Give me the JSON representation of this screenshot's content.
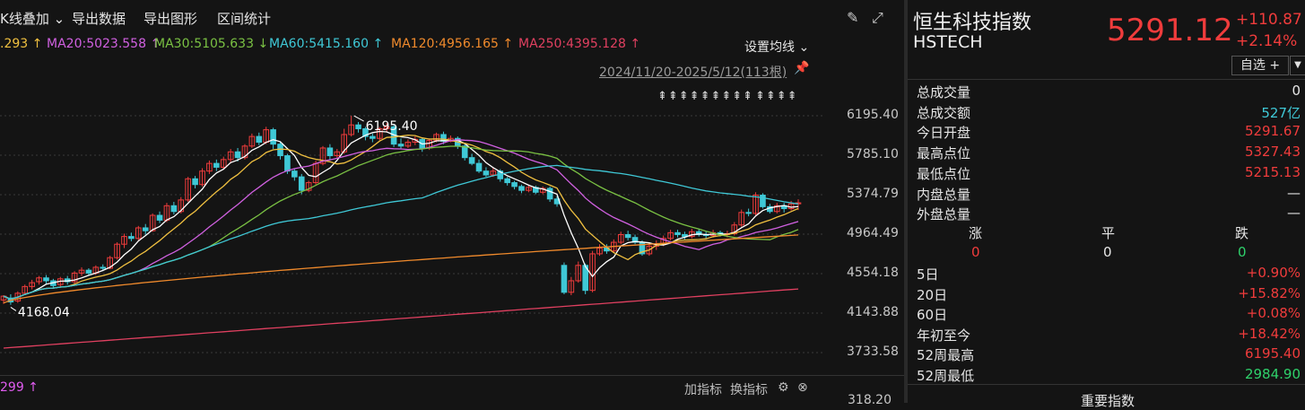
{
  "toolbar": {
    "kline_overlay": "K线叠加",
    "export_data": "导出数据",
    "export_chart": "导出图形",
    "range_stats": "区间统计",
    "icons": [
      "edit-icon",
      "expand-icon"
    ]
  },
  "ma_legend": [
    {
      "text": ".293",
      "color": "#f0c040",
      "arrow": "↑"
    },
    {
      "text": "MA20:5023.558",
      "color": "#d060e0",
      "arrow": "↑"
    },
    {
      "text": "MA30:5105.633",
      "color": "#7ac143",
      "arrow": "↓"
    },
    {
      "text": "MA60:5415.160",
      "color": "#3fc8d6",
      "arrow": "↑"
    },
    {
      "text": "MA120:4956.165",
      "color": "#f08a2c",
      "arrow": "↑"
    },
    {
      "text": "MA250:4395.128",
      "color": "#e04060",
      "arrow": "↑"
    }
  ],
  "ma_settings": "设置均线",
  "date_range": "2024/11/20-2025/5/12(113根)",
  "signal_groups": [
    "⇞⇞⇞⇞⇞⇞⇞⇞⇞",
    "⇞⇞⇞⇞"
  ],
  "chart_data": {
    "type": "candlestick",
    "y_ticks": [
      "6195.40",
      "5785.10",
      "5374.79",
      "4964.49",
      "4554.18",
      "4143.88",
      "3733.58"
    ],
    "ylim": [
      3600,
      6400
    ],
    "annotations": {
      "high_label": "6195.40",
      "low_label": "4168.04"
    },
    "colors": {
      "up": "#f03c3c",
      "down": "#3fc8d6",
      "ma5": "#ffffff",
      "ma10": "#f0c040",
      "ma20": "#d060e0",
      "ma30": "#7ac143",
      "ma60": "#3fc8d6",
      "ma120": "#f08a2c",
      "ma250": "#e04060"
    },
    "candles": [
      [
        4280,
        4320,
        4240,
        4330
      ],
      [
        4300,
        4260,
        4230,
        4340
      ],
      [
        4270,
        4350,
        4250,
        4370
      ],
      [
        4350,
        4420,
        4330,
        4440
      ],
      [
        4420,
        4460,
        4390,
        4490
      ],
      [
        4470,
        4510,
        4440,
        4530
      ],
      [
        4510,
        4480,
        4450,
        4540
      ],
      [
        4480,
        4430,
        4400,
        4500
      ],
      [
        4440,
        4500,
        4420,
        4520
      ],
      [
        4500,
        4470,
        4440,
        4530
      ],
      [
        4470,
        4560,
        4450,
        4580
      ],
      [
        4560,
        4590,
        4530,
        4620
      ],
      [
        4590,
        4560,
        4540,
        4610
      ],
      [
        4560,
        4620,
        4540,
        4640
      ],
      [
        4620,
        4610,
        4580,
        4650
      ],
      [
        4610,
        4720,
        4600,
        4740
      ],
      [
        4720,
        4860,
        4700,
        4880
      ],
      [
        4860,
        4940,
        4820,
        4970
      ],
      [
        4940,
        4920,
        4890,
        4980
      ],
      [
        4920,
        5030,
        4900,
        5050
      ],
      [
        5030,
        5000,
        4960,
        5070
      ],
      [
        5000,
        5160,
        4990,
        5180
      ],
      [
        5160,
        5110,
        5080,
        5200
      ],
      [
        5110,
        5260,
        5090,
        5290
      ],
      [
        5260,
        5200,
        5170,
        5300
      ],
      [
        5200,
        5320,
        5180,
        5350
      ],
      [
        5320,
        5540,
        5300,
        5560
      ],
      [
        5540,
        5480,
        5440,
        5570
      ],
      [
        5480,
        5620,
        5460,
        5650
      ],
      [
        5620,
        5700,
        5590,
        5730
      ],
      [
        5700,
        5660,
        5620,
        5740
      ],
      [
        5660,
        5740,
        5640,
        5770
      ],
      [
        5740,
        5820,
        5710,
        5850
      ],
      [
        5820,
        5760,
        5720,
        5860
      ],
      [
        5760,
        5880,
        5740,
        5900
      ],
      [
        5880,
        5980,
        5860,
        6010
      ],
      [
        5980,
        5920,
        5890,
        6020
      ],
      [
        5920,
        6050,
        5900,
        6080
      ],
      [
        6050,
        5900,
        5850,
        6070
      ],
      [
        5900,
        5780,
        5740,
        5930
      ],
      [
        5780,
        5620,
        5590,
        5800
      ],
      [
        5620,
        5560,
        5520,
        5640
      ],
      [
        5560,
        5420,
        5380,
        5590
      ],
      [
        5420,
        5500,
        5400,
        5520
      ],
      [
        5500,
        5700,
        5480,
        5730
      ],
      [
        5700,
        5860,
        5680,
        5880
      ],
      [
        5860,
        5780,
        5740,
        5900
      ],
      [
        5780,
        5820,
        5760,
        5850
      ],
      [
        5820,
        6000,
        5800,
        6060
      ],
      [
        6000,
        6100,
        5980,
        6195
      ],
      [
        6100,
        6060,
        6020,
        6130
      ],
      [
        6060,
        5980,
        5940,
        6080
      ],
      [
        5980,
        5960,
        5920,
        6010
      ],
      [
        5960,
        6060,
        5940,
        6080
      ],
      [
        6060,
        6080,
        6020,
        6120
      ],
      [
        6080,
        5900,
        5870,
        6100
      ],
      [
        5900,
        5880,
        5850,
        5960
      ],
      [
        5880,
        5920,
        5860,
        5950
      ],
      [
        5920,
        5950,
        5890,
        5980
      ],
      [
        5950,
        5860,
        5820,
        5970
      ],
      [
        5860,
        5940,
        5840,
        5960
      ],
      [
        5940,
        6000,
        5920,
        6020
      ],
      [
        6000,
        5930,
        5900,
        6030
      ],
      [
        5930,
        5960,
        5920,
        5990
      ],
      [
        5960,
        5880,
        5850,
        5980
      ],
      [
        5880,
        5760,
        5730,
        5900
      ],
      [
        5760,
        5700,
        5680,
        5800
      ],
      [
        5700,
        5620,
        5600,
        5740
      ],
      [
        5620,
        5580,
        5560,
        5660
      ],
      [
        5580,
        5620,
        5560,
        5660
      ],
      [
        5620,
        5540,
        5510,
        5640
      ],
      [
        5540,
        5500,
        5470,
        5560
      ],
      [
        5500,
        5460,
        5430,
        5520
      ],
      [
        5460,
        5420,
        5390,
        5480
      ],
      [
        5420,
        5450,
        5400,
        5480
      ],
      [
        5450,
        5400,
        5380,
        5470
      ],
      [
        5400,
        5440,
        5380,
        5460
      ],
      [
        5440,
        5330,
        5300,
        5460
      ],
      [
        5330,
        5280,
        5250,
        5360
      ],
      [
        4640,
        4360,
        4340,
        4670
      ],
      [
        4360,
        4480,
        4330,
        4520
      ],
      [
        4480,
        4640,
        4460,
        4680
      ],
      [
        4640,
        4380,
        4340,
        4660
      ],
      [
        4380,
        4760,
        4360,
        4790
      ],
      [
        4760,
        4820,
        4740,
        4860
      ],
      [
        4820,
        4790,
        4760,
        4860
      ],
      [
        4790,
        4880,
        4770,
        4910
      ],
      [
        4880,
        4960,
        4860,
        4990
      ],
      [
        4960,
        4930,
        4900,
        5000
      ],
      [
        4930,
        4880,
        4860,
        4960
      ],
      [
        4880,
        4760,
        4740,
        4900
      ],
      [
        4760,
        4840,
        4740,
        4870
      ],
      [
        4840,
        4860,
        4800,
        4900
      ],
      [
        4860,
        4920,
        4840,
        4950
      ],
      [
        4920,
        4980,
        4900,
        5010
      ],
      [
        4980,
        4960,
        4930,
        5010
      ],
      [
        4960,
        4940,
        4910,
        4990
      ],
      [
        4940,
        4990,
        4920,
        5020
      ],
      [
        4990,
        4960,
        4940,
        5020
      ],
      [
        4960,
        4950,
        4920,
        4990
      ],
      [
        4950,
        4980,
        4930,
        5010
      ],
      [
        4980,
        4960,
        4940,
        5000
      ],
      [
        4960,
        4970,
        4930,
        5000
      ],
      [
        4970,
        5060,
        4950,
        5090
      ],
      [
        5060,
        5190,
        5040,
        5220
      ],
      [
        5190,
        5180,
        5150,
        5230
      ],
      [
        5180,
        5370,
        5160,
        5400
      ],
      [
        5370,
        5250,
        5230,
        5390
      ],
      [
        5250,
        5200,
        5180,
        5280
      ],
      [
        5200,
        5260,
        5180,
        5290
      ],
      [
        5260,
        5230,
        5190,
        5290
      ],
      [
        5230,
        5280,
        5210,
        5310
      ],
      [
        5280,
        5290,
        5215,
        5327
      ]
    ]
  },
  "bottom": {
    "indicator_value": "299 ↑",
    "add_indicator": "加指标",
    "change_indicator": "换指标",
    "y_last": "318.20"
  },
  "panel": {
    "name": "恒生科技指数",
    "code": "HSTECH",
    "price": "5291.12",
    "change": "+110.87",
    "change_pct": "+2.14%",
    "watchlist": "自选 +",
    "stats": [
      {
        "label": "总成交量",
        "value": "0",
        "color": "white"
      },
      {
        "label": "总成交额",
        "value": "527亿",
        "color": "teal"
      },
      {
        "label": "今日开盘",
        "value": "5291.67",
        "color": "red"
      },
      {
        "label": "最高点位",
        "value": "5327.43",
        "color": "red"
      },
      {
        "label": "最低点位",
        "value": "5215.13",
        "color": "red"
      },
      {
        "label": "内盘总量",
        "value": "—",
        "color": "white"
      },
      {
        "label": "外盘总量",
        "value": "—",
        "color": "white"
      }
    ],
    "breadth": {
      "up_label": "涨",
      "flat_label": "平",
      "down_label": "跌",
      "up": "0",
      "flat": "0",
      "down": "0"
    },
    "perf": [
      {
        "label": "5日",
        "value": "+0.90%",
        "color": "red"
      },
      {
        "label": "20日",
        "value": "+15.82%",
        "color": "red"
      },
      {
        "label": "60日",
        "value": "+0.08%",
        "color": "red"
      },
      {
        "label": "年初至今",
        "value": "+18.42%",
        "color": "red"
      },
      {
        "label": "52周最高",
        "value": "6195.40",
        "color": "red"
      },
      {
        "label": "52周最低",
        "value": "2984.90",
        "color": "green"
      }
    ],
    "footer_tab": "重要指数"
  }
}
